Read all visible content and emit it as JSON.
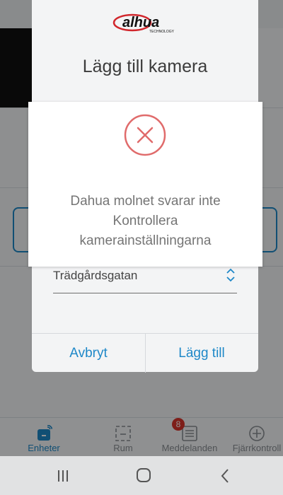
{
  "sheet": {
    "title": "Lägg till kamera",
    "location_value": "Trädgårdsgatan",
    "cancel_label": "Avbryt",
    "add_label": "Lägg till"
  },
  "dialog": {
    "message_line1": "Dahua molnet svarar inte",
    "message_line2": "Kontrollera",
    "message_line3": "kamerainställningarna",
    "icon": "error-x-circle-icon"
  },
  "logo_text": "alhua",
  "logo_subtext": "TECHNOLOGY",
  "bottom_nav": {
    "items": [
      {
        "label": "Enheter",
        "icon": "camera-device-icon",
        "active": true
      },
      {
        "label": "Rum",
        "icon": "room-icon",
        "active": false
      },
      {
        "label": "Meddelanden",
        "icon": "messages-icon",
        "active": false,
        "badge": "8"
      },
      {
        "label": "Fjärrkontroll",
        "icon": "remote-plus-icon",
        "active": false
      }
    ]
  },
  "system_bar": {
    "buttons": [
      "recent-apps-icon",
      "home-icon",
      "back-icon"
    ]
  },
  "colors": {
    "accent": "#1e88c8",
    "error": "#e06b6b",
    "badge": "#d9342b",
    "logo_red": "#d1262c"
  }
}
